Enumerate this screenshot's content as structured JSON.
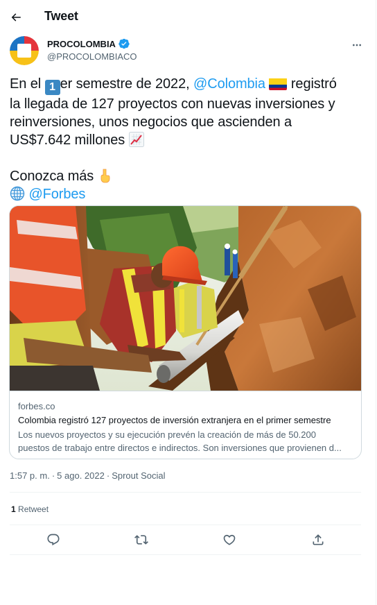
{
  "header": {
    "title": "Tweet",
    "back_icon": "arrow-left-icon"
  },
  "author": {
    "display_name": "PROCOLOMBIA",
    "handle": "@PROCOLOMBIACO",
    "verified": true,
    "verified_color": "#1d9bf0"
  },
  "tweet": {
    "line1_a": "En el",
    "line1_keycap": "1",
    "line1_b": "er semestre de 2022,",
    "line1_mention": "@Colombia",
    "line1_c": "registró",
    "line2": "la llegada de 127 proyectos con nuevas inversiones y",
    "line3": "reinversiones, unos negocios que ascienden a",
    "line4": "US$7.642 millones",
    "line5": "Conozca más",
    "line6_mention": "@Forbes",
    "emojis": [
      "keycap-1-emoji",
      "colombia-flag-emoji",
      "chart-increasing-emoji",
      "pointing-down-emoji",
      "globe-emoji"
    ]
  },
  "card": {
    "domain": "forbes.co",
    "title": "Colombia registró 127 proyectos de inversión extranjera en el primer semestre",
    "desc_line1": "Los nuevos proyectos y su ejecución prevén la creación de más de 50.200",
    "desc_line2": "puestos de trabajo entre directos e indirectos. Son inversiones que provienen d..."
  },
  "meta": {
    "time": "1:57 p. m.",
    "date": "5 ago. 2022",
    "source": "Sprout Social",
    "separator": "·"
  },
  "stats": {
    "retweet_count": "1",
    "retweet_label": "Retweet"
  },
  "actions": {
    "reply_icon": "reply-icon",
    "retweet_icon": "retweet-icon",
    "like_icon": "heart-icon",
    "share_icon": "share-icon"
  },
  "colors": {
    "accent": "#1d9bf0",
    "text": "#0f1419",
    "secondary": "#536471",
    "border": "#cfd9de"
  }
}
